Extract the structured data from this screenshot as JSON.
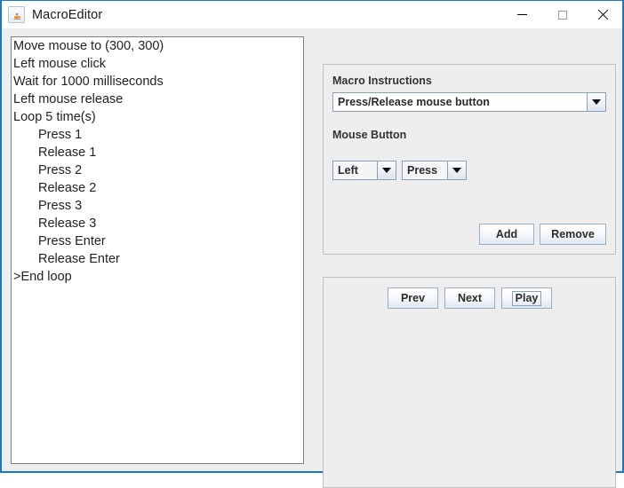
{
  "window": {
    "title": "MacroEditor",
    "icon": "java-coffee-cup-icon",
    "accent_border": "#1879c8",
    "titlebar_bg": "#ffffff",
    "client_bg": "#eeeeee",
    "controls": {
      "minimize": "minimize-icon",
      "maximize": "maximize-icon",
      "close": "close-icon"
    }
  },
  "macro_list": {
    "items": [
      {
        "text": "Move mouse to (300, 300)",
        "indent": 0
      },
      {
        "text": "Left mouse click",
        "indent": 0
      },
      {
        "text": "Wait for 1000 milliseconds",
        "indent": 0
      },
      {
        "text": "Left mouse release",
        "indent": 0
      },
      {
        "text": "Loop 5 time(s)",
        "indent": 0
      },
      {
        "text": "Press 1",
        "indent": 1
      },
      {
        "text": "Release 1",
        "indent": 1
      },
      {
        "text": "Press 2",
        "indent": 1
      },
      {
        "text": "Release 2",
        "indent": 1
      },
      {
        "text": "Press 3",
        "indent": 1
      },
      {
        "text": "Release 3",
        "indent": 1
      },
      {
        "text": "Press Enter",
        "indent": 1
      },
      {
        "text": "Release Enter",
        "indent": 1
      },
      {
        "text": ">End loop",
        "indent": 0
      }
    ]
  },
  "editor_panel": {
    "instruction_label": "Macro Instructions",
    "instruction_combo": {
      "value": "Press/Release mouse button"
    },
    "mouse_button_label": "Mouse Button",
    "button_combo": {
      "value": "Left"
    },
    "action_combo": {
      "value": "Press"
    },
    "add_button": "Add",
    "remove_button": "Remove"
  },
  "playback_panel": {
    "prev_button": "Prev",
    "next_button": "Next",
    "play_button": "Play"
  }
}
